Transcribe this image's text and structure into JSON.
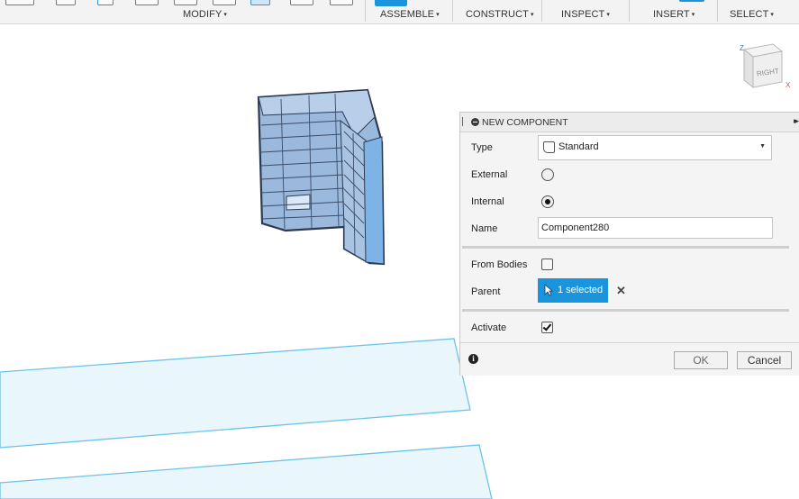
{
  "toolbar": {
    "modify_label": "MODIFY",
    "assemble_label": "ASSEMBLE",
    "construct_label": "CONSTRUCT",
    "inspect_label": "INSPECT",
    "insert_label": "INSERT",
    "select_label": "SELECT",
    "caret": "▾"
  },
  "viewcube": {
    "face_label": "RIGHT",
    "axis_z": "Z",
    "axis_x": "X"
  },
  "dialog": {
    "title": "NEW COMPONENT",
    "expand_icon": "▸▸",
    "type_label": "Type",
    "type_value": "Standard",
    "external_label": "External",
    "external_checked": false,
    "internal_label": "Internal",
    "internal_checked": true,
    "name_label": "Name",
    "name_value": "Component280",
    "from_bodies_label": "From Bodies",
    "from_bodies_checked": false,
    "parent_label": "Parent",
    "parent_selection": "1 selected",
    "clear_icon": "✕",
    "activate_label": "Activate",
    "activate_checked": true,
    "info_icon": "i",
    "ok_label": "OK",
    "cancel_label": "Cancel"
  },
  "colors": {
    "accent": "#1a95dd",
    "model_fill": "#9bb9dd",
    "model_edge": "#2b3a50",
    "sketch_plane": "#e9f6fc",
    "sketch_edge": "#6cc3e8"
  }
}
